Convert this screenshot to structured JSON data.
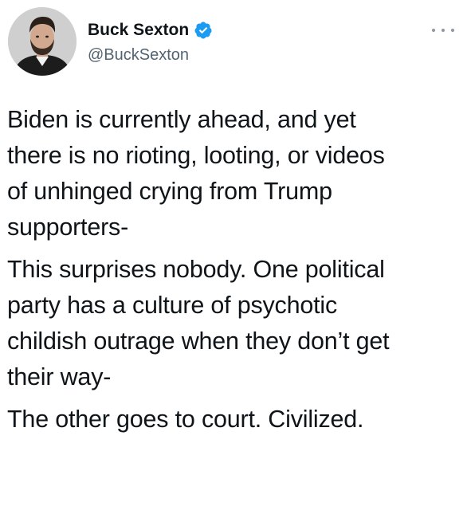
{
  "author": {
    "display_name": "Buck Sexton",
    "handle": "@BuckSexton",
    "verified": true,
    "verified_color": "#1d9bf0",
    "avatar_icon": "profile-photo"
  },
  "more_icon": "more-horizontal-icon",
  "tweet": {
    "paragraphs": [
      {
        "lines": [
          "Biden is currently ahead, and yet",
          "there is no rioting, looting, or videos",
          "of unhinged crying from Trump",
          "supporters-"
        ]
      },
      {
        "lines": [
          "This surprises nobody. One political",
          "party has a culture of psychotic",
          "childish outrage when they don’t get",
          "their way-"
        ]
      },
      {
        "lines": [
          "The other goes to court. Civilized."
        ]
      }
    ]
  }
}
